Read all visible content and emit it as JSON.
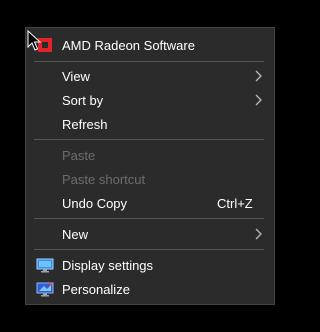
{
  "context_menu": {
    "header_item": {
      "label": "AMD Radeon Software",
      "icon": "amd-radeon-icon",
      "icon_color": "#e0252b"
    },
    "view_group": [
      {
        "label": "View",
        "submenu": true
      },
      {
        "label": "Sort by",
        "submenu": true
      },
      {
        "label": "Refresh",
        "submenu": false
      }
    ],
    "edit_group": [
      {
        "label": "Paste",
        "enabled": false
      },
      {
        "label": "Paste shortcut",
        "enabled": false
      },
      {
        "label": "Undo Copy",
        "enabled": true,
        "shortcut": "Ctrl+Z"
      }
    ],
    "new_item": {
      "label": "New",
      "submenu": true
    },
    "settings_group": [
      {
        "label": "Display settings",
        "icon": "display-settings-icon"
      },
      {
        "label": "Personalize",
        "icon": "personalize-icon"
      }
    ]
  },
  "colors": {
    "menu_background": "#2b2b2b",
    "text": "#ffffff",
    "disabled_text": "#6d6d6d",
    "separator": "#555555"
  }
}
